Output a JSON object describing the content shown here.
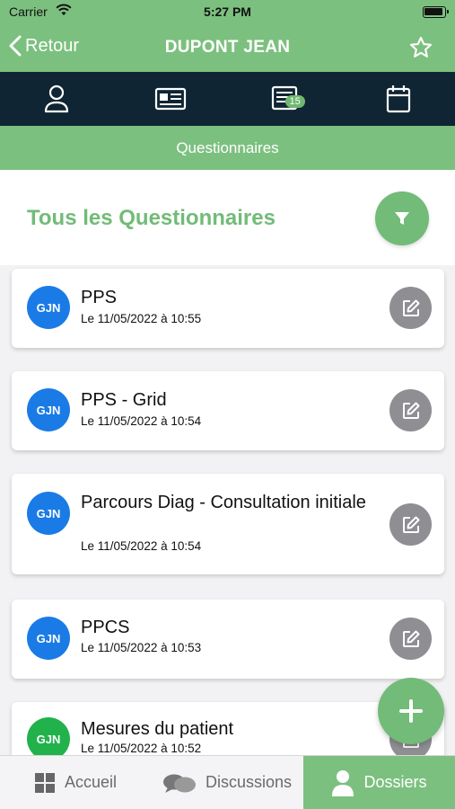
{
  "status_bar": {
    "carrier": "Carrier",
    "time": "5:27 PM"
  },
  "nav": {
    "back_label": "Retour",
    "title": "DUPONT JEAN"
  },
  "icon_tabs": [
    {
      "icon": "person-icon"
    },
    {
      "icon": "id-card-icon"
    },
    {
      "icon": "questionnaire-icon",
      "badge": "15"
    },
    {
      "icon": "calendar-icon"
    }
  ],
  "section": {
    "title": "Questionnaires"
  },
  "list": {
    "heading": "Tous les Questionnaires"
  },
  "questionnaires": [
    {
      "initials": "GJN",
      "avatar_color": "#1a7be6",
      "name": "PPS",
      "date": "Le 11/05/2022 à 10:55"
    },
    {
      "initials": "GJN",
      "avatar_color": "#1a7be6",
      "name": "PPS - Grid",
      "date": "Le 11/05/2022 à 10:54"
    },
    {
      "initials": "GJN",
      "avatar_color": "#1a7be6",
      "name": "Parcours Diag - Consultation initiale",
      "date": "Le 11/05/2022 à 10:54"
    },
    {
      "initials": "GJN",
      "avatar_color": "#1a7be6",
      "name": "PPCS",
      "date": "Le 11/05/2022 à 10:53"
    },
    {
      "initials": "GJN",
      "avatar_color": "#22b24c",
      "name": "Mesures du patient",
      "date": "Le 11/05/2022 à 10:52"
    }
  ],
  "bottom_tabs": {
    "home": {
      "label": "Accueil",
      "icon": "grid-icon"
    },
    "discussions": {
      "label": "Discussions",
      "icon": "chat-bubbles-icon"
    },
    "records": {
      "label": "Dossiers",
      "icon": "person-icon",
      "active": true
    }
  },
  "colors": {
    "primary_green": "#7cc07f",
    "dark_navy": "#0f2533",
    "edit_gray": "#8e8e93",
    "avatar_blue": "#1a7be6",
    "avatar_green": "#22b24c"
  }
}
